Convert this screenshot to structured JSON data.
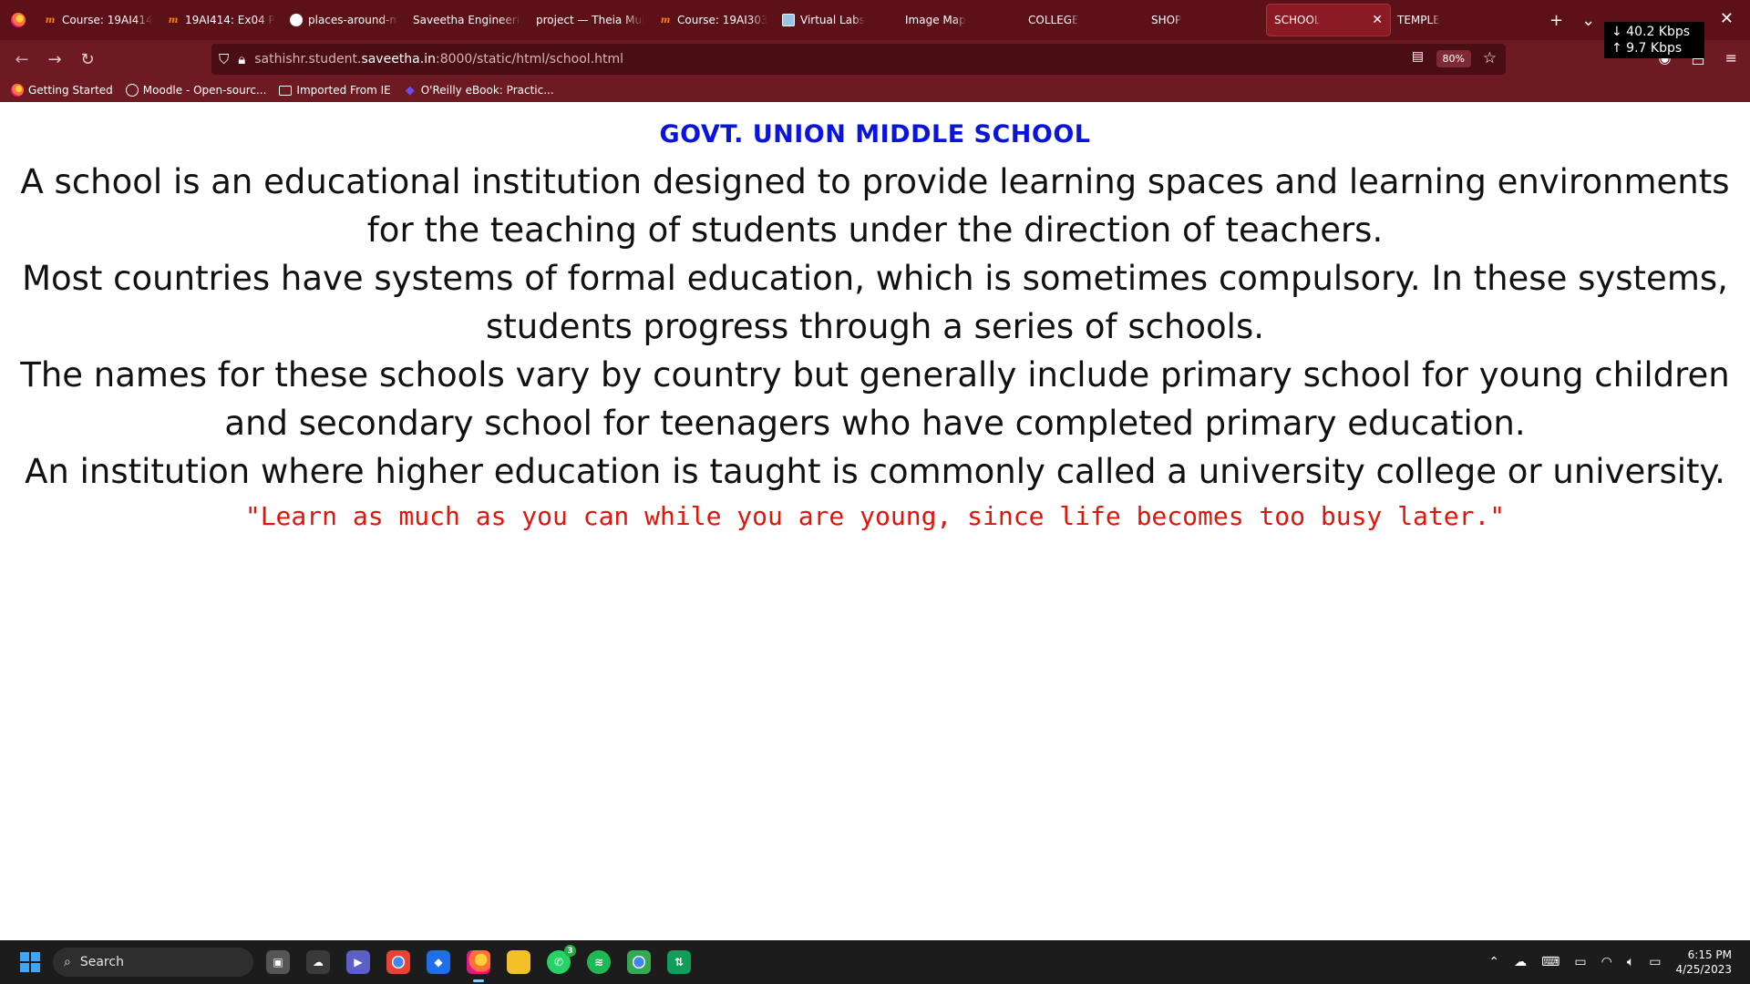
{
  "browser": {
    "tabs": [
      {
        "label": "Course: 19AI414-",
        "icon": "moodle-icon"
      },
      {
        "label": "19AI414: Ex04 Pla",
        "icon": "moodle-icon"
      },
      {
        "label": "places-around-m",
        "icon": "github-icon"
      },
      {
        "label": "Saveetha Engineering",
        "icon": "none"
      },
      {
        "label": "project — Theia Mult",
        "icon": "none"
      },
      {
        "label": "Course: 19AI303-",
        "icon": "moodle-icon"
      },
      {
        "label": "Virtual Labs",
        "icon": "virtual-labs-icon"
      },
      {
        "label": "Image Map",
        "icon": "none"
      },
      {
        "label": "COLLEGE",
        "icon": "none"
      },
      {
        "label": "SHOP",
        "icon": "none"
      },
      {
        "label": "SCHOOL",
        "icon": "none",
        "active": true
      },
      {
        "label": "TEMPLE",
        "icon": "none"
      }
    ],
    "new_tab": "+",
    "tab_list": "⌄",
    "net_down": "↓ 40.2 Kbps",
    "net_up": "↑ 9.7 Kbps",
    "close_window": "✕",
    "url_host_prefix": "sathishr.student.",
    "url_host_main": "saveetha.in",
    "url_rest": ":8000/static/html/school.html",
    "zoom": "80%",
    "bookmarks": [
      {
        "label": "Getting Started",
        "icon": "firefox-icon"
      },
      {
        "label": "Moodle - Open-sourc...",
        "icon": "globe-icon"
      },
      {
        "label": "Imported From IE",
        "icon": "folder-icon"
      },
      {
        "label": "O'Reilly eBook: Practic...",
        "icon": "oreilly-icon"
      }
    ]
  },
  "page": {
    "title": "GOVT. UNION MIDDLE SCHOOL",
    "paragraphs": [
      "A school is an educational institution designed to provide learning spaces and learning environments for the teaching of students under the direction of teachers.",
      "Most countries have systems of formal education, which is sometimes compulsory. In these systems, students progress through a series of schools.",
      "The names for these schools vary by country but generally include primary school for young children and secondary school for teenagers who have completed primary education.",
      "An institution where higher education is taught is commonly called a university college or university."
    ],
    "quote": "\"Learn as much as you can while you are young, since life becomes too busy later.\"",
    "title_color": "#0a14dc",
    "quote_color": "#e3140a"
  },
  "taskbar": {
    "search_label": "Search",
    "whatsapp_badge": "3",
    "time": "6:15 PM",
    "date": "4/25/2023"
  }
}
